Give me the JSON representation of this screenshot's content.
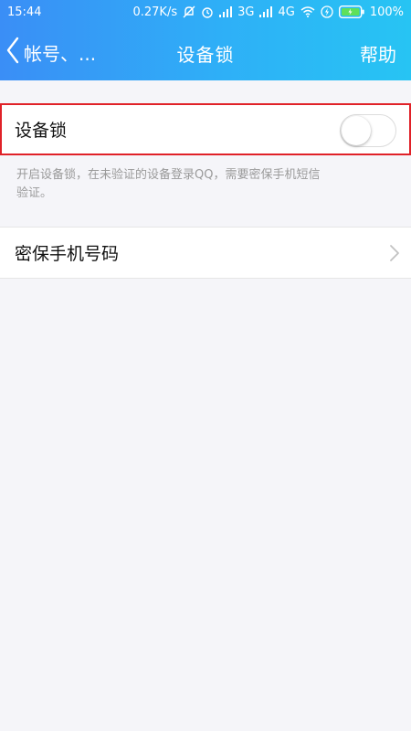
{
  "status_bar": {
    "time": "15:44",
    "network_speed": "0.27K/s",
    "signal_1": "3G",
    "signal_2": "4G",
    "battery": "100%"
  },
  "nav": {
    "back_label": "帐号、...",
    "title": "设备锁",
    "help_label": "帮助"
  },
  "device_lock": {
    "label": "设备锁",
    "enabled": false,
    "description": "开启设备锁，在未验证的设备登录QQ，需要密保手机短信验证。"
  },
  "security_phone": {
    "label": "密保手机号码"
  },
  "colors": {
    "header_gradient_start": "#3a8ef6",
    "header_gradient_end": "#27c4f3",
    "highlight_border": "#e02128",
    "background": "#f5f5f9"
  },
  "icons": [
    "silent-icon",
    "alarm-icon",
    "signal-icon",
    "wifi-icon",
    "charging-icon",
    "battery-icon",
    "back-chevron-icon",
    "chevron-right-icon"
  ]
}
